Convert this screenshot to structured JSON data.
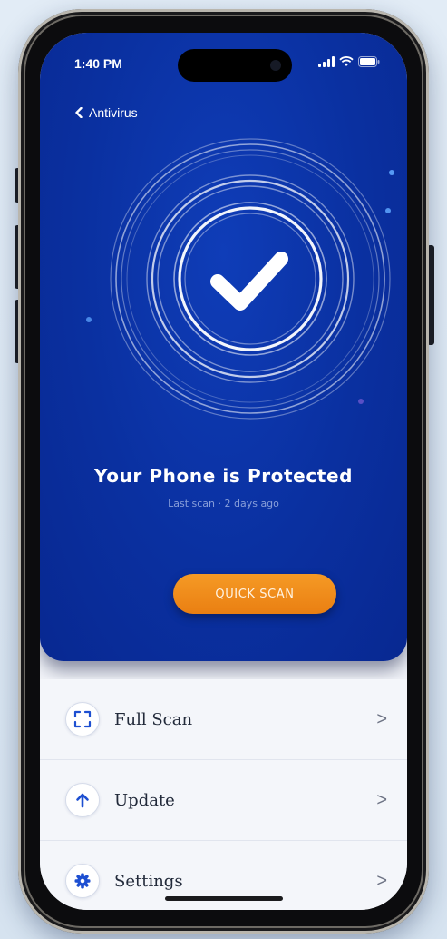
{
  "status_bar": {
    "time": "1:40 PM"
  },
  "nav": {
    "back_label": "Antivirus"
  },
  "hero": {
    "title": "Your Phone is Protected",
    "subtitle": "Last scan · 2 days ago",
    "scan_button_label": "QUICK SCAN"
  },
  "menu": {
    "items": [
      {
        "label": "Full Scan",
        "icon": "scan-frame-icon",
        "chevron": ">"
      },
      {
        "label": "Update",
        "icon": "arrow-up-icon",
        "chevron": ">"
      },
      {
        "label": "Settings",
        "icon": "gear-icon",
        "chevron": ">"
      }
    ]
  },
  "colors": {
    "hero_blue": "#0a30a0",
    "accent_orange": "#f08a1c",
    "ring_white": "#ffffff",
    "icon_blue": "#1d4fd1"
  }
}
